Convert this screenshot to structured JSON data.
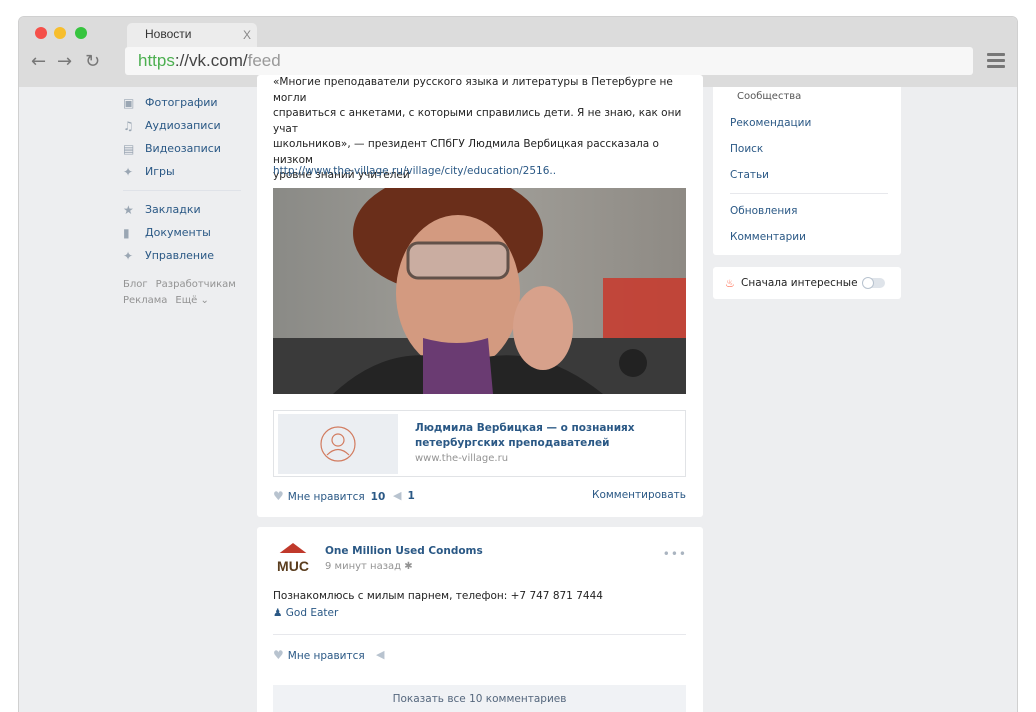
{
  "browser": {
    "tab_title": "Новости",
    "tab_close": "X",
    "url_scheme": "https",
    "url_host": "://vk.com/",
    "url_path": "feed"
  },
  "left_nav": {
    "items": [
      {
        "icon": "camera-icon",
        "label": "Фотографии"
      },
      {
        "icon": "music-icon",
        "label": "Аудиозаписи"
      },
      {
        "icon": "video-icon",
        "label": "Видеозаписи"
      },
      {
        "icon": "gamepad-icon",
        "label": "Игры"
      }
    ],
    "items2": [
      {
        "icon": "star-icon",
        "label": "Закладки"
      },
      {
        "icon": "document-icon",
        "label": "Документы"
      },
      {
        "icon": "gamepad-icon",
        "label": "Управление"
      }
    ],
    "footer": {
      "blog": "Блог",
      "developers": "Разработчикам",
      "ads": "Реклама",
      "more": "Ещё ⌄"
    }
  },
  "post1": {
    "text_lines": [
      "«Многие преподаватели русского языка и литературы в Петербурге не могли",
      "справиться с анкетами, с которыми справились дети. Я не знаю, как они учат",
      "школьников», — президент СПбГУ Людмила Вербицкая рассказала о низком",
      "уровне знаний учителей"
    ],
    "link": "http://www.the-village.ru/village/city/education/2516..",
    "card_title": "Людмила Вербицкая — о познаниях петербургских преподавателей",
    "card_domain": "www.the-village.ru",
    "like_label": "Мне нравится",
    "like_count": "10",
    "share_count": "1",
    "comment_label": "Комментировать"
  },
  "post2": {
    "author": "One Million Used Condoms",
    "time": "9 минут назад",
    "text": "Познакомлюсь с милым парнем, телефон: +7 747 871 7444",
    "signer": "God Eater",
    "like_label": "Мне нравится",
    "show_all": "Показать все 10 комментариев",
    "more": "•••",
    "avatar_text": "MUC"
  },
  "right_menu": {
    "current": "Сообщества",
    "items": [
      "Рекомендации",
      "Поиск",
      "Статьи"
    ],
    "items2": [
      "Обновления",
      "Комментарии"
    ],
    "toggle_label": "Сначала интересные",
    "toggle_on": false
  },
  "colors": {
    "link": "#2a5885",
    "page_bg": "#edeef0",
    "url_scheme": "#4caf50"
  }
}
